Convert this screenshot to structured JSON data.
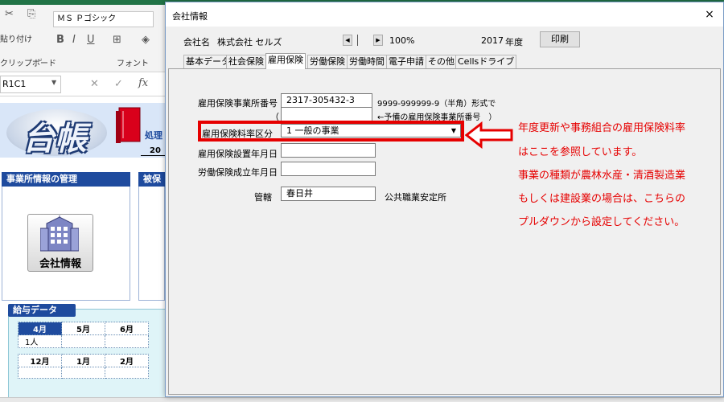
{
  "excel": {
    "clipboard_paste": "貼り付け",
    "clipboard_group": "クリップボード",
    "font_name": "ＭＳ Ｐゴシック",
    "font_group": "フォント",
    "cell_ref": "R1C1",
    "fx": "fx",
    "banner_logo": "台帳",
    "banner_tag": "処理",
    "banner_year": "20",
    "section_office": "事業所情報の管理",
    "section_insured": "被保",
    "company_button": "会社情報",
    "salary_header": "給与データ",
    "months_row1": [
      "4月",
      "5月",
      "6月"
    ],
    "months_row1_sub": [
      "1人",
      "",
      ""
    ],
    "months_row2": [
      "12月",
      "1月",
      "2月"
    ]
  },
  "dialog": {
    "title": "会社情報",
    "close": "×",
    "company_name_label": "会社名",
    "company_name_value": "株式会社 セルズ",
    "nav_prev": "◀",
    "nav_next": "▶",
    "zoom": "100%",
    "year_value": "2017",
    "year_label": "年度",
    "print_button": "印刷",
    "tabs": [
      "基本データ",
      "社会保険",
      "雇用保険",
      "労働保険",
      "労働時間",
      "電子申請",
      "その他",
      "Cellsドライブ"
    ],
    "active_tab": 2,
    "fields": {
      "office_no_label": "雇用保険事業所番号",
      "office_no_value": "2317-305432-3",
      "office_no_hint": "9999-999999-9（半角）形式で",
      "paren_open": "（",
      "reserve_hint": "←予備の雇用保険事業所番号　）",
      "rate_label": "雇用保険料率区分",
      "rate_value": "1 一般の事業",
      "setup_date_label": "雇用保険設置年月日",
      "setup_date_value": "",
      "labor_date_label": "労働保険成立年月日",
      "labor_date_value": "",
      "jurisdiction_label": "管轄",
      "jurisdiction_value": "春日井",
      "jurisdiction_suffix": "公共職業安定所"
    }
  },
  "annotation": {
    "lines": [
      "年度更新や事務組合の雇用保険料率",
      "はここを参照しています。",
      "事業の種類が農林水産・清酒製造業",
      "もしくは建設業の場合は、こちらの",
      "プルダウンから設定してください。"
    ],
    "color": "#e60000"
  }
}
